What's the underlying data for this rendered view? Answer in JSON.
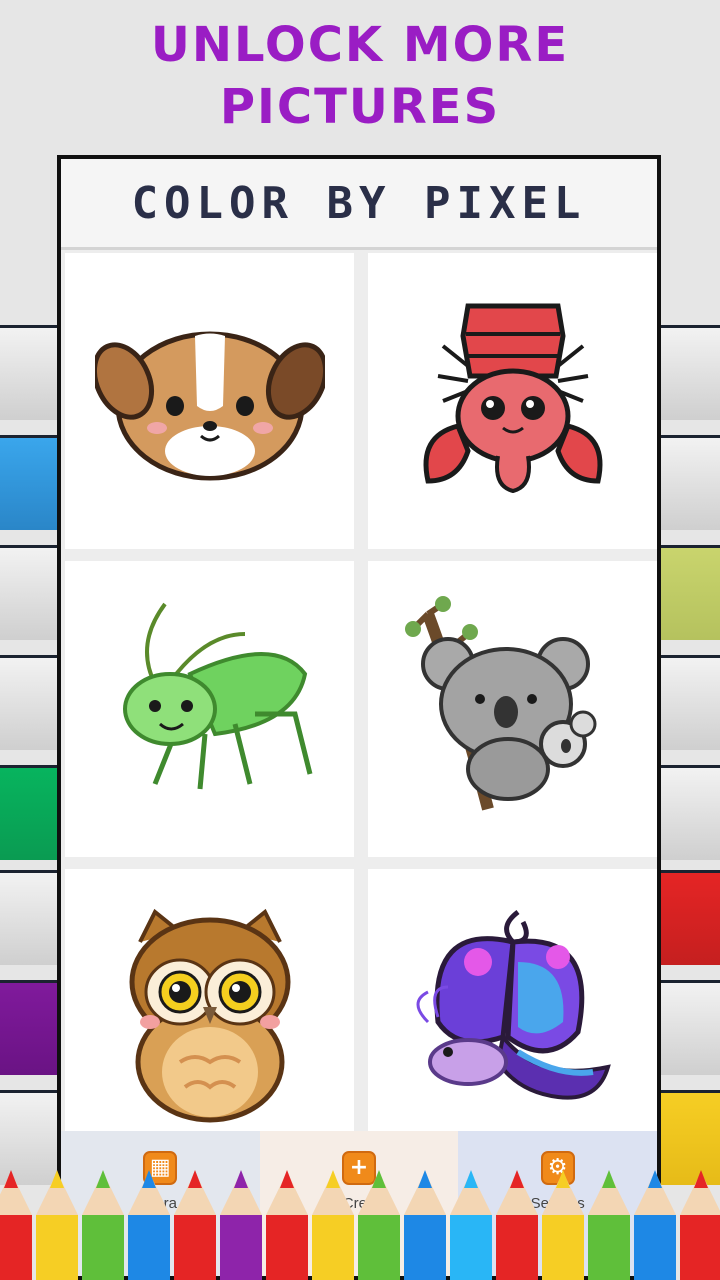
{
  "promo": {
    "line1": "UNLOCK MORE",
    "line2": "PICTURES"
  },
  "app": {
    "title": "COLOR BY PIXEL"
  },
  "gallery": {
    "items": [
      {
        "icon": "puppy-icon"
      },
      {
        "icon": "hermit-crab-icon"
      },
      {
        "icon": "grasshopper-icon"
      },
      {
        "icon": "koala-icon"
      },
      {
        "icon": "owl-icon"
      },
      {
        "icon": "butterfly-icon"
      }
    ]
  },
  "tabs": [
    {
      "label": "Libra",
      "icon": "grid-icon"
    },
    {
      "label": "Crea",
      "icon": "plus-icon"
    },
    {
      "label": "Settings",
      "icon": "gear-icon"
    }
  ],
  "colors": {
    "headline": "#9a1dc4",
    "title": "#2a2f48",
    "tab_icon": "#f08a1a",
    "stripe_blue": "#3aa6ec",
    "stripe_green": "#07b45e",
    "stripe_purple": "#801a9c",
    "stripe_lime": "#c9d46d",
    "stripe_red": "#e52525",
    "stripe_yellow": "#f6ce24"
  }
}
